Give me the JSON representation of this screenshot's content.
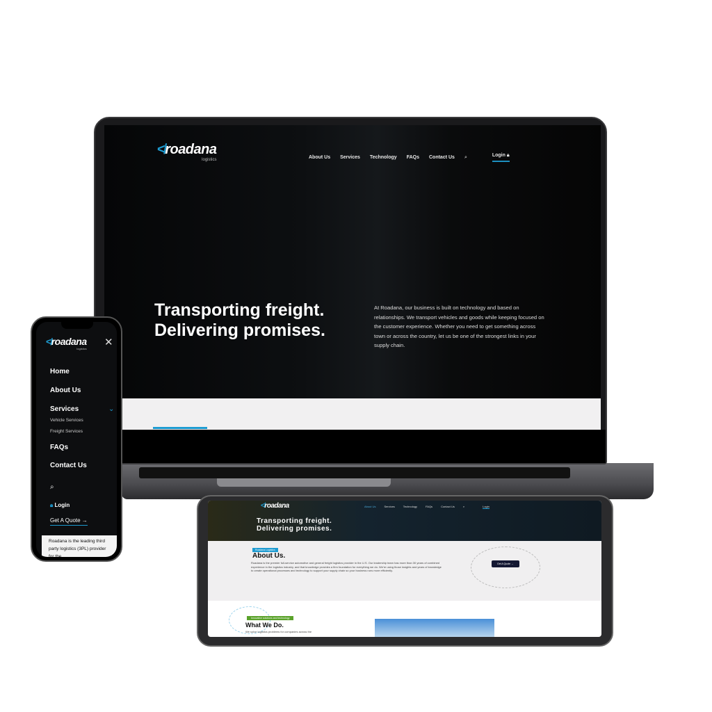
{
  "brand": {
    "name": "roadana",
    "tagline": "logistics",
    "accent": "#1d9bd1"
  },
  "laptop": {
    "nav": [
      {
        "label": "About Us"
      },
      {
        "label": "Services"
      },
      {
        "label": "Technology"
      },
      {
        "label": "FAQs"
      },
      {
        "label": "Contact Us"
      }
    ],
    "search_icon": "search-icon",
    "login": "Login",
    "hero_title_1": "Transporting freight.",
    "hero_title_2": "Delivering promises.",
    "hero_text": "At Roadana, our business is built on technology and based on relationships. We transport vehicles and goods while keeping focused on the customer experience. Whether you need to get something across town or across the country, let us be one of the strongest links in your supply chain."
  },
  "phone": {
    "menu": [
      {
        "label": "Home"
      },
      {
        "label": "About Us"
      },
      {
        "label": "Services"
      },
      {
        "label": "FAQs"
      },
      {
        "label": "Contact Us"
      }
    ],
    "submenu": [
      {
        "label": "Vehicle Services"
      },
      {
        "label": "Freight Services"
      }
    ],
    "login": "Login",
    "quote": "Get A Quote →",
    "bottom_text": "Roadana is the leading third party logistics (3PL) provider for the"
  },
  "tablet": {
    "nav": [
      {
        "label": "About Us"
      },
      {
        "label": "Services"
      },
      {
        "label": "Technology"
      },
      {
        "label": "FAQs"
      },
      {
        "label": "Contact Us"
      }
    ],
    "login": "Login",
    "hero_title_1": "Transporting freight.",
    "hero_title_2": "Delivering promises.",
    "about_tag": "Roadana Logistics",
    "about_title": "About Us.",
    "about_text": "Roadana is the premier full-service automotive and general freight logistics provider in the U.S. Our leadership team has more than 30 years of combined experience in the logistics industry, and that knowledge provides a firm foundation for everything we do. We're using those insights and years of knowledge to create operational processes and technology to support your supply chain so your business runs more efficiently.",
    "quote_button": "Get A Quote",
    "what_tag": "Innovative solutions and technology",
    "what_title": "What We Do.",
    "what_text": "We solve logistics problems for companies across the"
  }
}
